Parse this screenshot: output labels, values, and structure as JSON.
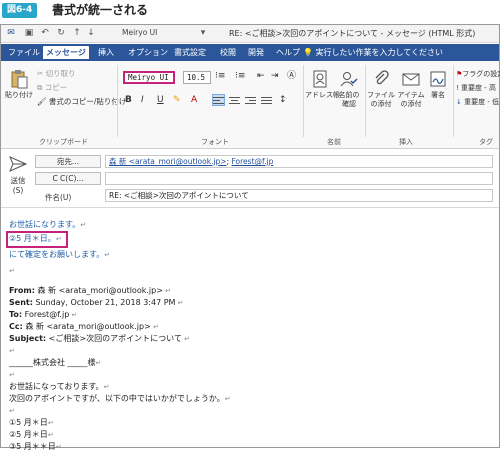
{
  "caption": {
    "badge": "図6-4",
    "title": "書式が統一される"
  },
  "titlebar": {
    "font_name": "Meiryo UI",
    "title": "RE: <ご相談>次回のアポイントについて - メッセージ (HTML 形式)"
  },
  "tabs": [
    "ファイル",
    "メッセージ",
    "挿入",
    "オプション",
    "書式設定",
    "校閲",
    "開発",
    "ヘルプ"
  ],
  "tell_me": "実行したい作業を入力してください",
  "ribbon": {
    "clipboard": {
      "paste": "貼り付け",
      "cut": "切り取り",
      "copy": "コピー",
      "format_painter": "書式のコピー/貼り付け",
      "label": "クリップボード"
    },
    "font": {
      "font_name": "Meiryo UI",
      "font_size": "10.5",
      "bold": "B",
      "italic": "I",
      "underline": "U",
      "label": "フォント"
    },
    "names": {
      "address_book": "アドレス帳",
      "check_names": "名前の確認",
      "label": "名前"
    },
    "include": {
      "attach_file": "ファイルの添付",
      "attach_item": "アイテムの添付",
      "signature": "署名",
      "label": "挿入"
    },
    "tags": {
      "flag": "フラグの設定",
      "high_importance": "重要度 - 高",
      "low_importance": "重要度 - 低",
      "label": "タグ"
    }
  },
  "header": {
    "send": "送信(S)",
    "to_label": "宛先...",
    "cc_label": "C C(C)...",
    "subject_label": "件名(U)",
    "to_value_name": "森 新 <arata_mori@outlook.jp>",
    "to_value_sep": ";",
    "to_value_second": "Forest@f.jp",
    "cc_value": "",
    "subject_value": "RE: <ご相談>次回のアポイントについて"
  },
  "body": {
    "greeting": "お世話になります。",
    "date_highlight": "②5 月＊日。",
    "confirm": "にて確定をお願いします。",
    "from_label": "From:",
    "from_value": "森 新 <arata_mori@outlook.jp>",
    "sent_label": "Sent:",
    "sent_value": "Sunday, October 21, 2018 3:47 PM",
    "to_label": "To:",
    "to_value": "Forest@f.jp",
    "cc_label": "Cc:",
    "cc_value": "森 新 <arata_mori@outlook.jp>",
    "subject_label": "Subject:",
    "subject_value": "<ご相談>次回のアポイントについて",
    "company": "______株式会社 _____様",
    "q_greeting": "お世話になっております。",
    "q_line": "次回のアポイントですが、以下の中ではいかがでしょうか。",
    "opt1": "①5 月＊日",
    "opt2": "②5 月＊日",
    "opt3": "③5 月＊＊日"
  }
}
